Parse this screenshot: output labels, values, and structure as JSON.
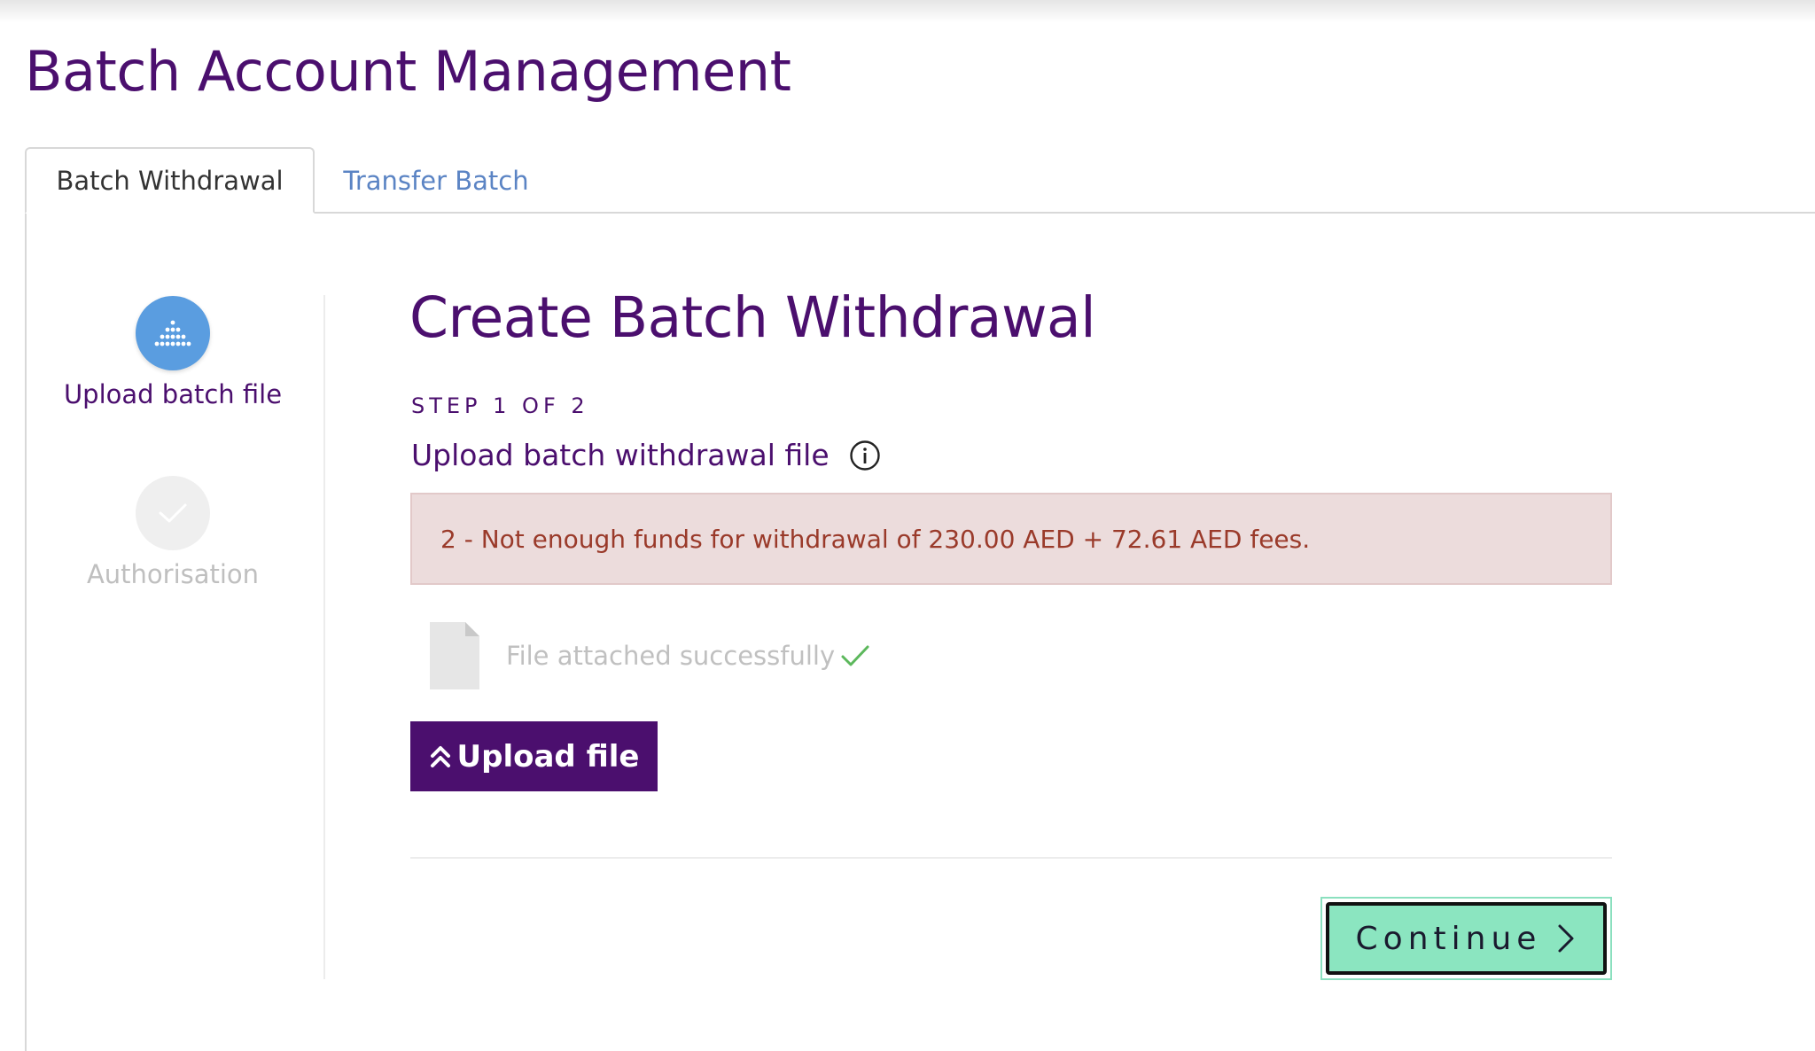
{
  "page": {
    "title": "Batch Account Management"
  },
  "tabs": [
    {
      "label": "Batch Withdrawal",
      "active": true
    },
    {
      "label": "Transfer Batch",
      "active": false
    }
  ],
  "stepper": {
    "steps": [
      {
        "label": "Upload batch file",
        "state": "active",
        "icon": "dots-grid-icon"
      },
      {
        "label": "Authorisation",
        "state": "pending",
        "icon": "check-icon"
      }
    ]
  },
  "main": {
    "title": "Create Batch Withdrawal",
    "step_counter": "STEP 1 OF 2",
    "upload_heading": "Upload batch withdrawal file",
    "info_icon": "info-icon",
    "error_message": "2 - Not enough funds for withdrawal of 230.00 AED + 72.61 AED fees.",
    "file_status": "File attached successfully",
    "upload_button_label": "Upload file",
    "continue_button_label": "Continue"
  },
  "colors": {
    "brand_purple": "#4b0f6e",
    "step_active_blue": "#5a9de0",
    "error_bg": "#ecdcdc",
    "error_text": "#9a3a2a",
    "success_green": "#5cb85c",
    "continue_green": "#8be5c0",
    "tab_link_blue": "#5b84c4"
  }
}
